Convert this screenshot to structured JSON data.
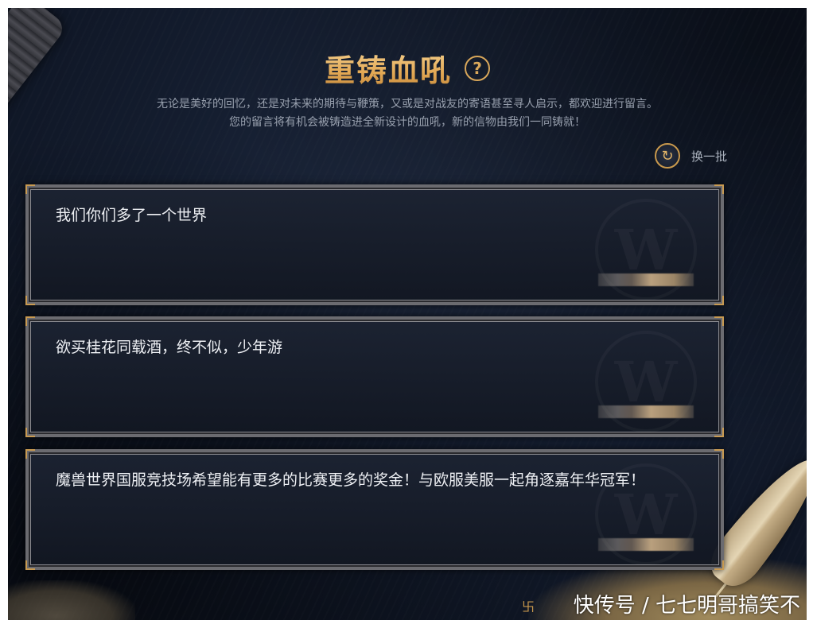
{
  "header": {
    "title": "重铸血吼",
    "help_glyph": "?",
    "subtitle_line1": "无论是美好的回忆，还是对未来的期待与鞭策，又或是对战友的寄语甚至寻人启示，都欢迎进行留言。",
    "subtitle_line2": "您的留言将有机会被铸造进全新设计的血吼，新的信物由我们一同铸就！"
  },
  "refresh": {
    "icon": "refresh-icon",
    "label": "换一批"
  },
  "messages": [
    {
      "text": "我们你们多了一个世界"
    },
    {
      "text": "欲买桂花同载酒，终不似，少年游"
    },
    {
      "text": "魔兽世界国服竞技场希望能有更多的比赛更多的奖金！与欧服美服一起角逐嘉年华冠军！"
    }
  ],
  "watermark_glyph": "W",
  "credit": {
    "text": "快传号 / 七七明哥搞笑不"
  },
  "colors": {
    "title_gold": "#e8b865",
    "background": "#141d2f",
    "card_border": "#6b6b70",
    "accent_gold": "#c89a52",
    "message_text": "#eef0f4",
    "subtitle_text": "#98a0ae"
  }
}
